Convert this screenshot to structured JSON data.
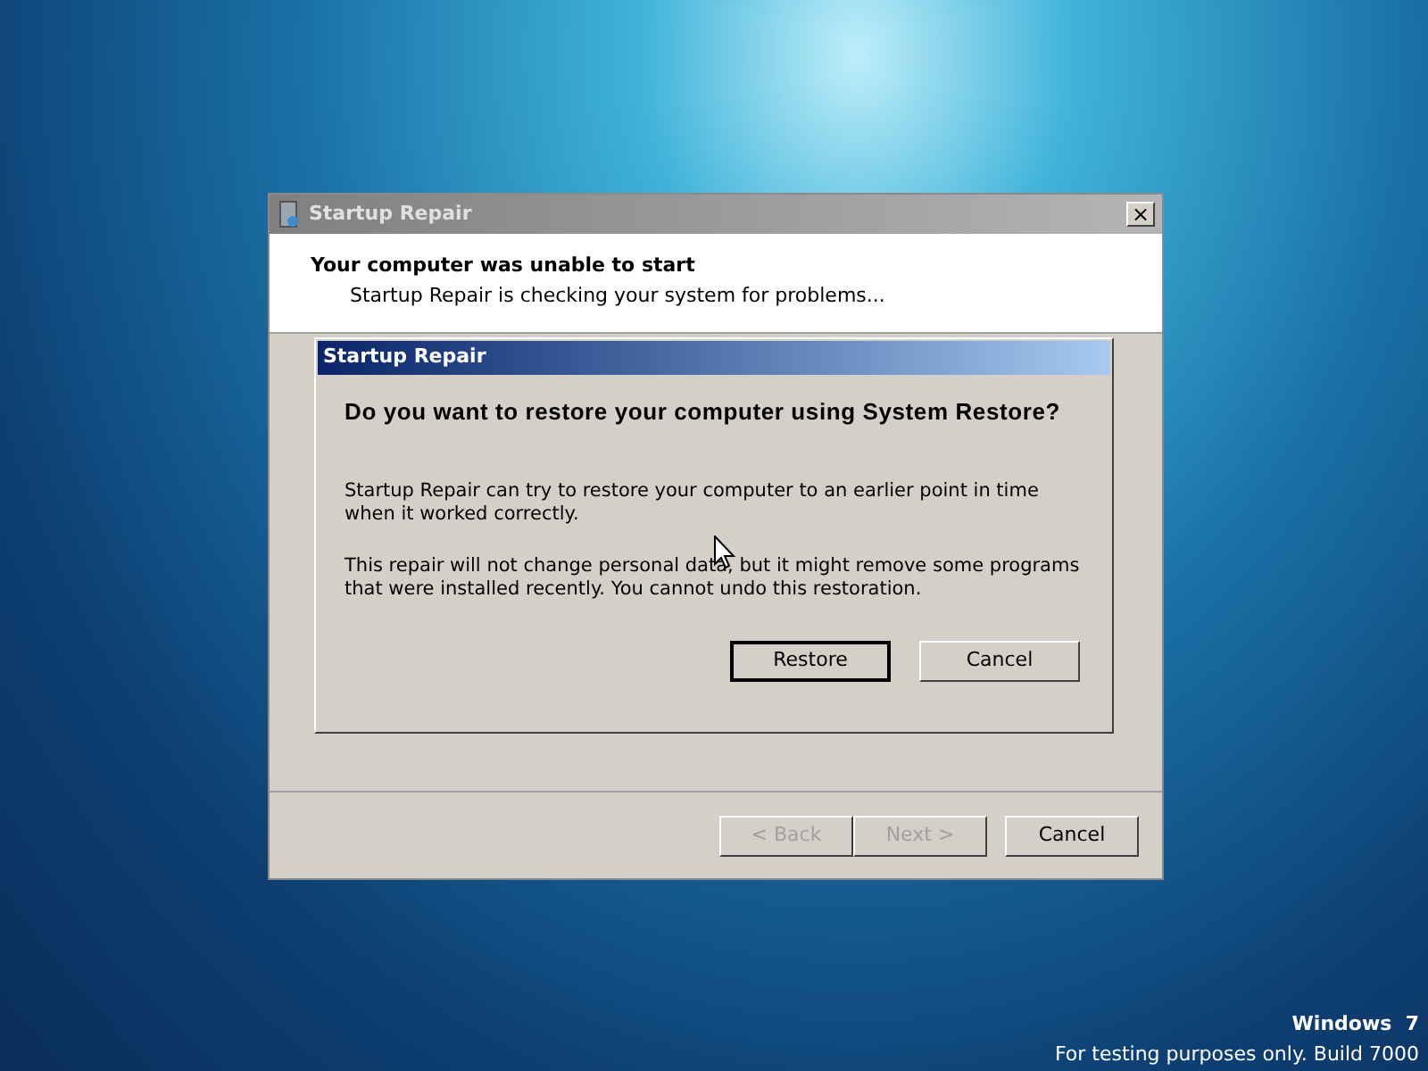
{
  "window": {
    "title": "Startup Repair",
    "heading": "Your computer was unable to start",
    "subheading": "Startup Repair is checking your system for problems...",
    "close": "×",
    "buttons": [
      {
        "label": "< Back",
        "disabled": true
      },
      {
        "label": "Next >",
        "disabled": true
      },
      {
        "label": "Cancel",
        "disabled": false
      }
    ]
  },
  "dialog": {
    "title": "Startup Repair",
    "question": "Do you want to restore your computer using System Restore?",
    "paragraphs": [
      "Startup Repair can try to restore your computer to an earlier point in time when it worked correctly.",
      "This repair will not change personal data, but it might remove some programs that were installed recently. You cannot undo this restoration."
    ],
    "buttons": [
      {
        "label": "Restore",
        "default": true
      },
      {
        "label": "Cancel",
        "default": false
      }
    ]
  },
  "watermark_os": {
    "name": "Windows  7",
    "build": "For testing purposes only. Build 7000"
  }
}
